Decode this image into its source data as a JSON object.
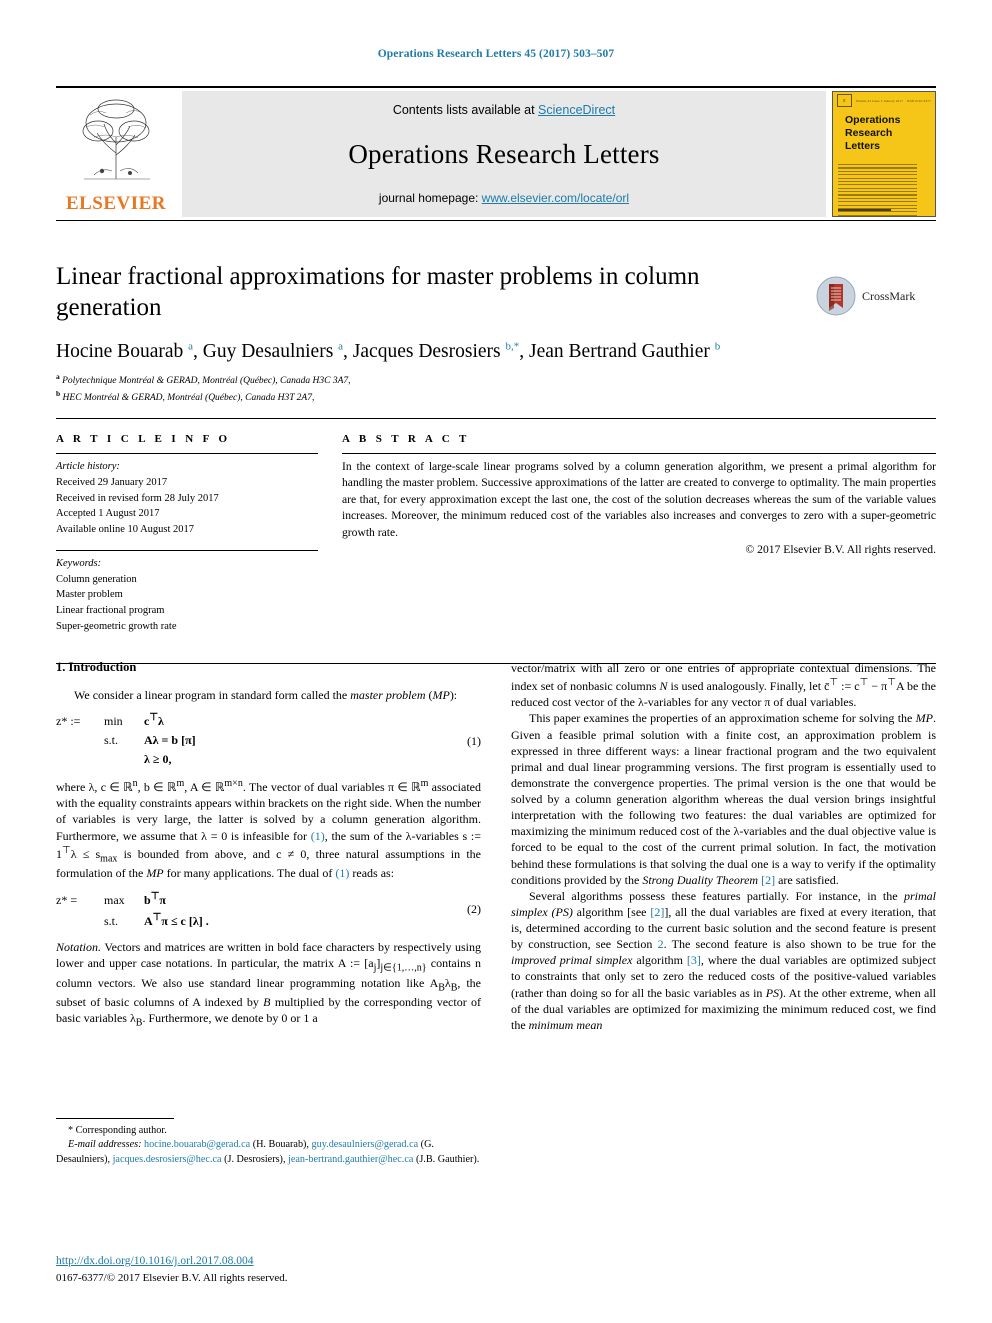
{
  "running_head": "Operations Research Letters 45 (2017) 503–507",
  "masthead": {
    "publisher_name": "ELSEVIER",
    "contents_prefix": "Contents lists available at ",
    "contents_link": "ScienceDirect",
    "journal_title": "Operations Research Letters",
    "homepage_prefix": "journal homepage: ",
    "homepage_url": "www.elsevier.com/locate/orl",
    "cover": {
      "title_line1": "Operations",
      "title_line2": "Research",
      "title_line3": "Letters",
      "top_left_micro": "Volume 45 Issue 5 January 2017",
      "top_right_micro": "ISSN 0167-6377"
    }
  },
  "article": {
    "title": "Linear fractional approximations for master problems in column generation",
    "crossmark_label": "CrossMark",
    "authors_html": "Hocine Bouarab <sup>a</sup>, Guy Desaulniers <sup>a</sup>, Jacques Desrosiers <sup>b,*</sup>, Jean Bertrand Gauthier <sup>b</sup>",
    "affiliations": [
      {
        "mark": "a",
        "text": "Polytechnique Montréal & GERAD, Montréal (Québec), Canada H3C 3A7,"
      },
      {
        "mark": "b",
        "text": "HEC Montréal & GERAD, Montréal (Québec), Canada H3T 2A7,"
      }
    ]
  },
  "info": {
    "heading": "A R T I C L E   I N F O",
    "history_label": "Article history:",
    "history": [
      "Received 29 January 2017",
      "Received in revised form 28 July 2017",
      "Accepted 1 August 2017",
      "Available online 10 August 2017"
    ],
    "keywords_label": "Keywords:",
    "keywords": [
      "Column generation",
      "Master problem",
      "Linear fractional program",
      "Super-geometric growth rate"
    ]
  },
  "abstract": {
    "heading": "A B S T R A C T",
    "text": "In the context of large-scale linear programs solved by a column generation algorithm, we present a primal algorithm for handling the master problem. Successive approximations of the latter are created to converge to optimality. The main properties are that, for every approximation except the last one, the cost of the solution decreases whereas the sum of the variable values increases. Moreover, the minimum reduced cost of the variables also increases and converges to zero with a super-geometric growth rate.",
    "copyright": "© 2017 Elsevier B.V. All rights reserved."
  },
  "body": {
    "section1_title": "1.  Introduction",
    "left": {
      "p1_html": "We consider a linear program in standard form called the <i>master problem</i> (<i>MP</i>):",
      "eq1": {
        "lhs": "z* :=",
        "r1c2": "min",
        "r1c3": "c<sup>⊤</sup>λ",
        "r2c2": "s.t.",
        "r2c3": "Aλ  = b   [π]",
        "r3c3": "λ  ≥ 0,",
        "number": "(1)"
      },
      "p2_html": "where λ, c ∈ ℝ<sup>n</sup>, b ∈ ℝ<sup>m</sup>, A ∈ ℝ<sup>m×n</sup>. The vector of dual variables π ∈ ℝ<sup>m</sup> associated with the equality constraints appears within brackets on the right side. When the number of variables is very large, the latter is solved by a column generation algorithm. Furthermore, we assume that λ = 0 is infeasible for <span class=\"ref\">(1)</span>, the sum of the λ-variables s := 1<sup>⊤</sup>λ ≤ s<sub>max</sub> is bounded from above, and c ≠ 0, three natural assumptions in the formulation of the <i>MP</i> for many applications. The dual of <span class=\"ref\">(1)</span> reads as:",
      "eq2": {
        "lhs": "z* =",
        "r1c2": "max",
        "r1c3": "b<sup>⊤</sup>π",
        "r2c2": "s.t.",
        "r2c3": "A<sup>⊤</sup>π ≤ c   [λ] .",
        "number": "(2)"
      },
      "p3_html": "<i>Notation.</i> Vectors and matrices are written in bold face characters by respectively using lower and upper case notations. In particular, the matrix A := [a<sub>j</sub>]<sub>j∈{1,…,n}</sub> contains n column vectors. We also use standard linear programming notation like A<sub>B</sub>λ<sub>B</sub>, the subset of basic columns of A indexed by <i>B</i> multiplied by the corresponding vector of basic variables λ<sub>B</sub>. Furthermore, we denote by 0 or 1 a"
    },
    "right": {
      "p1_html": "vector/matrix with all zero or one entries of appropriate contextual dimensions. The index set of nonbasic columns <i>N</i> is used analogously. Finally, let c̄<sup>⊤</sup> := c<sup>⊤</sup> − π<sup>⊤</sup>A be the reduced cost vector of the λ-variables for any vector π of dual variables.",
      "p2_html": "This paper examines the properties of an approximation scheme for solving the <i>MP</i>. Given a feasible primal solution with a finite cost, an approximation problem is expressed in three different ways: a linear fractional program and the two equivalent primal and dual linear programming versions. The first program is essentially used to demonstrate the convergence properties. The primal version is the one that would be solved by a column generation algorithm whereas the dual version brings insightful interpretation with the following two features: the dual variables are optimized for maximizing the minimum reduced cost of the λ-variables and the dual objective value is forced to be equal to the cost of the current primal solution. In fact, the motivation behind these formulations is that solving the dual one is a way to verify if the optimality conditions provided by the <i>Strong Duality Theorem</i> <span class=\"ref\">[2]</span> are satisfied.",
      "p3_html": "Several algorithms possess these features partially. For instance, in the <i>primal simplex (PS)</i> algorithm [see <span class=\"ref\">[2]</span>], all the dual variables are fixed at every iteration, that is, determined according to the current basic solution and the second feature is present by construction, see Section <span class=\"ref\">2</span>. The second feature is also shown to be true for the <i>improved primal simplex</i> algorithm <span class=\"ref\">[3]</span>, where the dual variables are optimized subject to constraints that only set to zero the reduced costs of the positive-valued variables (rather than doing so for all the basic variables as in <i>PS</i>). At the other extreme, when all of the dual variables are optimized for maximizing the minimum reduced cost, we find the <i>minimum mean</i>"
    }
  },
  "footnotes": {
    "corresponding": "*  Corresponding author.",
    "email_label": "E-mail addresses:",
    "emails_html": "<span class=\"link\">hocine.bouarab@gerad.ca</span> (H. Bouarab), <span class=\"link\">guy.desaulniers@gerad.ca</span> (G. Desaulniers), <span class=\"link\">jacques.desrosiers@hec.ca</span> (J. Desrosiers), <span class=\"link\">jean-bertrand.gauthier@hec.ca</span> (J.B. Gauthier).",
    "doi": "http://dx.doi.org/10.1016/j.orl.2017.08.004",
    "issn": "0167-6377/© 2017 Elsevier B.V. All rights reserved."
  },
  "colors": {
    "link": "#1f7ba8",
    "elsevier_orange": "#E87722",
    "cover_yellow": "#F5C518",
    "band_grey": "#e8e8e8"
  }
}
